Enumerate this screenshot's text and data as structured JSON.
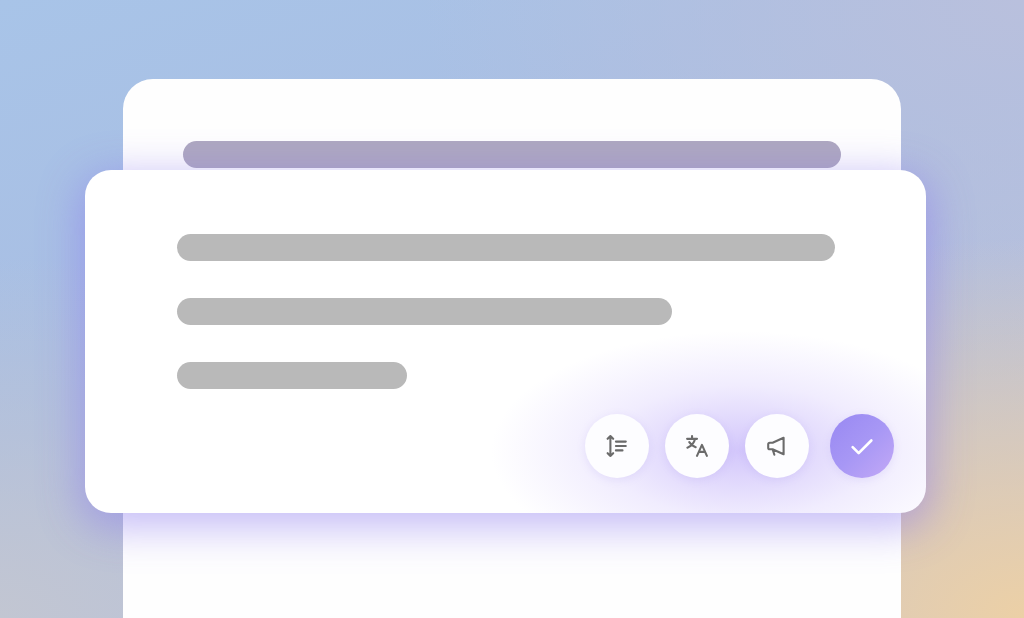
{
  "back_card": {
    "lines": [
      {
        "kind": "long"
      }
    ]
  },
  "front_card": {
    "lines": [
      {
        "kind": "long"
      },
      {
        "kind": "medium"
      },
      {
        "kind": "short"
      }
    ],
    "actions": [
      {
        "kind": "plain"
      },
      {
        "kind": "plain"
      },
      {
        "kind": "plain"
      },
      {
        "kind": "primary"
      }
    ]
  }
}
